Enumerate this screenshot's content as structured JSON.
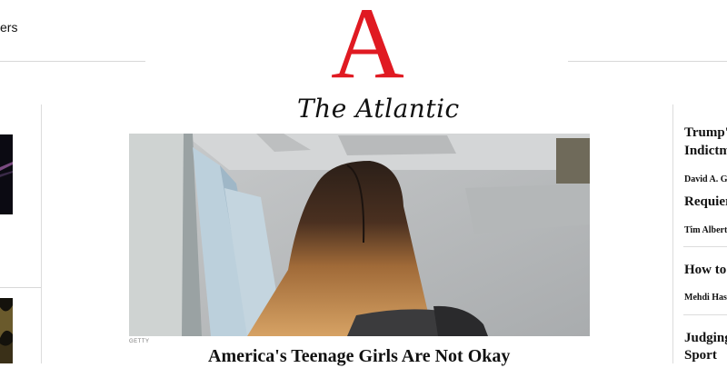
{
  "nav": {
    "partial_item": "ers"
  },
  "brand": {
    "logo_letter": "A",
    "name": "The Atlantic",
    "logo_color": "#e01a22"
  },
  "hero": {
    "credit": "GETTY",
    "headline": "America's Teenage Girls Are Not Okay"
  },
  "right_rail": {
    "items": [
      {
        "title_lines": [
          "Trump's",
          "Indictm"
        ],
        "author": "David A. G"
      },
      {
        "title_lines": [
          "Requier"
        ],
        "author": "Tim Albert"
      },
      {
        "title_lines": [
          "How to "
        ],
        "author": "Mehdi Has"
      },
      {
        "title_lines": [
          "Judging",
          "Sport"
        ],
        "author": ""
      }
    ]
  }
}
